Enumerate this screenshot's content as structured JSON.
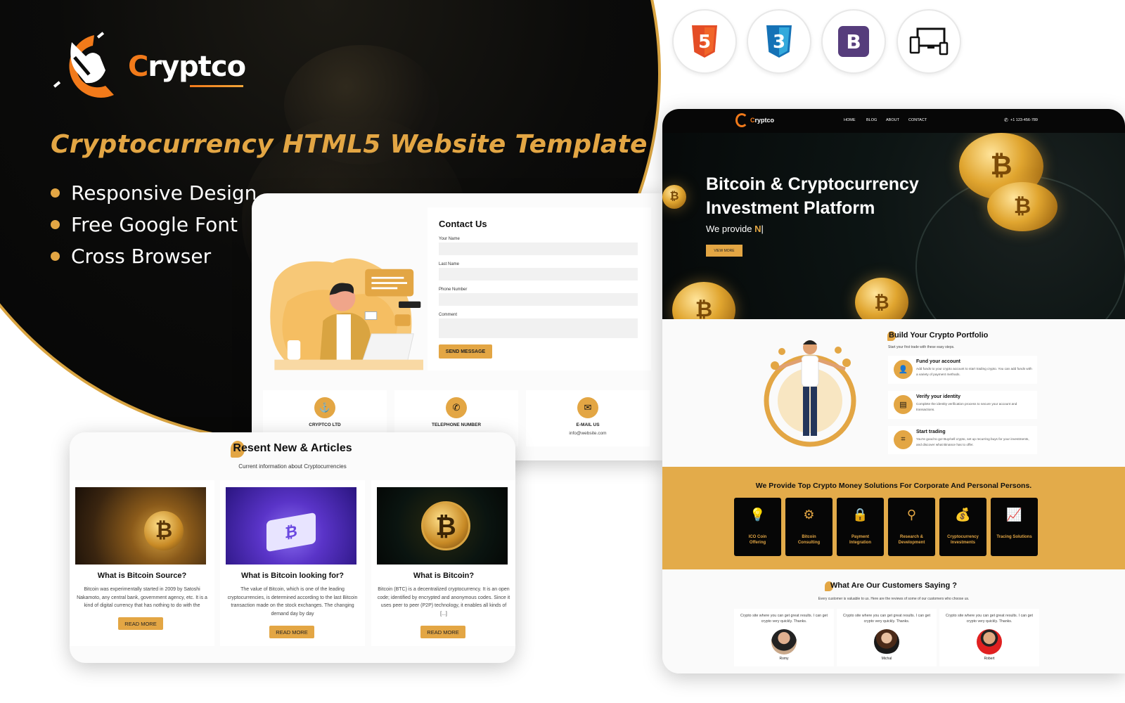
{
  "banner": {
    "brand": {
      "first_letter": "C",
      "rest": "ryptco"
    },
    "headline": "Cryptocurrency HTML5 Website Template",
    "features": [
      "Responsive Design",
      "Free Google Font",
      "Cross Browser"
    ],
    "tech_badges": [
      {
        "name": "html5-icon",
        "label": "5"
      },
      {
        "name": "css3-icon",
        "label": "3"
      },
      {
        "name": "bootstrap-icon",
        "label": "B"
      },
      {
        "name": "responsive-devices-icon",
        "label": ""
      }
    ],
    "colors": {
      "accent": "#e3a644",
      "logo_orange": "#f27a1a",
      "dark": "#070707"
    }
  },
  "contact": {
    "title": "Contact Us",
    "fields": [
      {
        "label": "Your Name",
        "value": ""
      },
      {
        "label": "Last Name",
        "value": ""
      },
      {
        "label": "Phone Number",
        "value": ""
      },
      {
        "label": "Comment",
        "value": ""
      }
    ],
    "send_label": "SEND MESSAGE",
    "info": [
      {
        "title": "CRYPTCO LTD",
        "sub": ""
      },
      {
        "title": "TELEPHONE NUMBER",
        "sub": ""
      },
      {
        "title": "E-MAIL US",
        "sub": "info@website.com"
      }
    ]
  },
  "news": {
    "title_first": "R",
    "title_rest": "esent New & Articles",
    "subtitle": "Current information about Cryptocurrencies",
    "articles": [
      {
        "title": "What is Bitcoin Source?",
        "text": "Bitcoin was experimentally started in 2009 by Satoshi Nakamoto, any central bank, government agency, etc. It is a kind of digital currency that has nothing to do with the",
        "button": "READ MORE"
      },
      {
        "title": "What is Bitcoin looking for?",
        "text": "The value of Bitcoin, which is one of the leading cryptocurrencies, is determined according to the last Bitcoin transaction made on the stock exchanges. The changing demand day by day",
        "button": "READ MORE"
      },
      {
        "title": "What is Bitcoin?",
        "text": "Bitcoin (BTC) is a decentralized cryptocurrency. It is an open code; identified by encrypted and anonymous codes. Since it uses peer to peer (P2P) technology, it enables all kinds of [...]",
        "button": "READ MORE"
      }
    ]
  },
  "site": {
    "brand": {
      "first_letter": "C",
      "rest": "ryptco"
    },
    "nav": [
      "HOME",
      "BLOG",
      "ABOUT",
      "CONTACT"
    ],
    "phone": "+1 123-456-789",
    "hero": {
      "title_line1": "Bitcoin & Cryptocurrency",
      "title_line2": "Investment Platform",
      "sub_prefix": "We provide ",
      "sub_typed": "N",
      "button": "VIEW MORE"
    },
    "portfolio": {
      "title_first": "B",
      "title_rest": "uild Your Crypto Portfolio",
      "subtitle": "Start your first trade with these easy steps.",
      "steps": [
        {
          "title": "Fund your account",
          "text": "Add funds to your crypto account to start trading crypto. You can add funds with a variety of payment methods."
        },
        {
          "title": "Verify your identity",
          "text": "Complete the identity verification process to secure your account and transactions."
        },
        {
          "title": "Start trading",
          "text": "You're good to go! Buy/sell crypto, set up recurring buys for your investments, and discover what Binance has to offer."
        }
      ]
    },
    "solutions": {
      "title": "We Provide Top Crypto Money Solutions For Corporate And Personal Persons.",
      "items": [
        {
          "label_1": "ICO Coin",
          "label_2": "Offering",
          "icon": "bulb-coin-icon"
        },
        {
          "label_1": "Bitcoin",
          "label_2": "Consulting",
          "icon": "bitcoin-network-icon"
        },
        {
          "label_1": "Payment",
          "label_2": "Integration",
          "icon": "payment-lock-icon"
        },
        {
          "label_1": "Research &",
          "label_2": "Development",
          "icon": "research-icon"
        },
        {
          "label_1": "Cryptocurrency",
          "label_2": "Investments",
          "icon": "money-bag-icon"
        },
        {
          "label_1": "Tracing Solutions",
          "label_2": "",
          "icon": "chart-trend-icon"
        }
      ]
    },
    "testimonials": {
      "title_first": "W",
      "title_rest": "hat Are Our Customers Saying ?",
      "subtitle": "Every customer is valuable to us. Here are the reviews of some of our customers who choose us.",
      "items": [
        {
          "quote": "Crypto site where you can get great results. I can get crypto very quickly. Thanks.",
          "name": "Romy"
        },
        {
          "quote": "Crypto site where you can get great results. I can get crypto very quickly. Thanks.",
          "name": "Michal"
        },
        {
          "quote": "Crypto site where you can get great results. I can get crypto very quickly. Thanks.",
          "name": "Robert"
        }
      ]
    }
  }
}
